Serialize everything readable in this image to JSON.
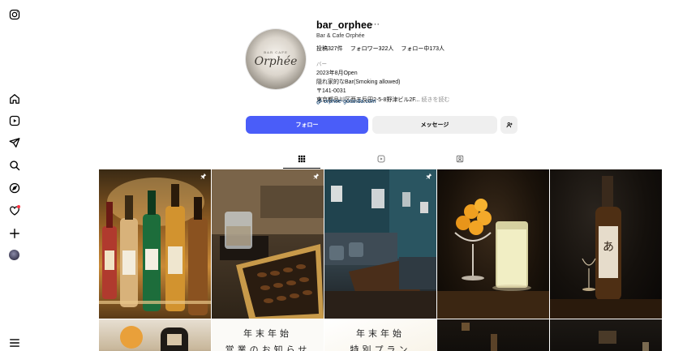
{
  "nav": {
    "items": [
      {
        "name": "instagram-logo-icon"
      },
      {
        "name": "home-icon"
      },
      {
        "name": "reels-icon"
      },
      {
        "name": "direct-send-icon"
      },
      {
        "name": "search-icon"
      },
      {
        "name": "explore-compass-icon"
      },
      {
        "name": "notifications-heart-icon"
      },
      {
        "name": "create-plus-icon"
      },
      {
        "name": "profile-avatar"
      },
      {
        "name": "menu-icon"
      }
    ],
    "notification_color": "#ff3040"
  },
  "profile": {
    "pic_small_text": "BAR CAFE",
    "pic_big_text": "Orphée",
    "username": "bar_orphee",
    "more_label": "···",
    "category_line": "Bar & Cafe Orphée",
    "stats": {
      "posts": "投稿327件",
      "followers": "フォロワー322人",
      "following": "フォロー中173人"
    },
    "bio_label": "バー",
    "bio_lines": [
      "2023年8月Open",
      "隠れ家的なBar(Smoking allowed)",
      "〒141-0031"
    ],
    "bio_address": "東京都品川区西五反田2-5-8野津ビル2F...",
    "bio_more": "続きを読む",
    "link_text": "orphee-gotanda.com"
  },
  "actions": {
    "follow_label": "フォロー",
    "message_label": "メッセージ",
    "follow_color": "#4a5df9",
    "secondary_color": "#efefef"
  },
  "tabs": [
    {
      "name": "tab-posts",
      "icon": "grid-icon",
      "active": true
    },
    {
      "name": "tab-reels",
      "icon": "reels-icon",
      "active": false
    },
    {
      "name": "tab-tagged",
      "icon": "tagged-user-icon",
      "active": false
    }
  ],
  "grid": {
    "row1": [
      {
        "name": "post-bottles",
        "pinned": true
      },
      {
        "name": "post-whisky-and-dates",
        "pinned": true
      },
      {
        "name": "post-bar-interior",
        "pinned": true
      },
      {
        "name": "post-orange-highball",
        "pinned": false
      },
      {
        "name": "post-whisky-bottle",
        "pinned": false
      }
    ],
    "row2": [
      {
        "name": "post-bartender",
        "text": ""
      },
      {
        "name": "post-new-year-hours",
        "text": "年末年始\n営業のお知らせ"
      },
      {
        "name": "post-new-year-special",
        "text": "年末年始\n特別プラン"
      },
      {
        "name": "post-dark-bar-1",
        "text": ""
      },
      {
        "name": "post-dark-bar-2",
        "text": ""
      }
    ]
  }
}
